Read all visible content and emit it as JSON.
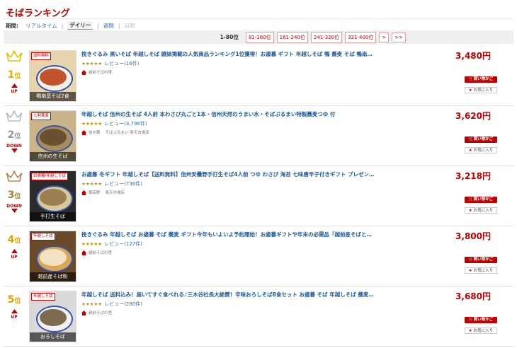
{
  "page": {
    "title": "そばランキング"
  },
  "period": {
    "label": "期間:",
    "options": [
      "リアルタイム",
      "デイリー",
      "週間",
      "月間"
    ]
  },
  "pager": {
    "current": "1-80位",
    "pages": [
      "81-160位",
      "161-240位",
      "241-320位",
      "321-400位",
      ">",
      ">>"
    ]
  },
  "colors": {
    "accent": "#bf0000",
    "link": "#1d5b9b",
    "gold": "#e6c000",
    "silver": "#b0bec5",
    "bronze": "#b08a55"
  },
  "labels": {
    "cart": "買い物かご",
    "fav": "お気に入り",
    "rank_suffix": "位"
  },
  "items": [
    {
      "rank": "1",
      "change": "UP",
      "title": "挽きぐるみ 黒いそば 年越しそば 雑誌掲載の人気商品ランキング1位獲得！お歳暮 ギフト 年越しそば 鴨 蕎麦 そば 鴨南…",
      "stars": "★★★★★",
      "reviews": "レビュー(16件)",
      "shop": "越前そばの里",
      "shop_extra": "",
      "price": "3,480円",
      "img_caption": "鴨南蛮そば2食",
      "img_tag": "送料無料"
    },
    {
      "rank": "2",
      "change": "DOWN",
      "title": "年越しそば 信州の生そば 4人前 本わさび丸ごと1本・信州天然のうまい水・そばぷるまい特製蕎麦つゆ 付",
      "stars": "★★★★★",
      "reviews": "レビュー(3,796件)",
      "shop": "信州蕎",
      "shop_extra": "そばぷるまい 楽天市場店",
      "price": "3,620円",
      "img_caption": "信州の生そば",
      "img_tag": "七割蕎麦"
    },
    {
      "rank": "3",
      "change": "DOWN",
      "title": "お歳暮 冬ギフト 年越しそば【送料無料】信州安曇野手打生そば4人前 つゆ わさび 海苔 七味唐辛子付きギフト プレゼン…",
      "stars": "★★★★★",
      "reviews": "レビュー(736件)",
      "shop": "穂高野",
      "shop_extra": "楽天市場店",
      "price": "3,218円",
      "img_caption": "手打生そば",
      "img_tag": "お歳暮/年越しそば"
    },
    {
      "rank": "4",
      "change": "UP",
      "title": "挽きぐるみ 年越しそば お歳暮 そば 蕎麦 ギフト今年もいよいよ予約開始！お歳暮ギフトや年末の必需品「越前産そばと…",
      "stars": "★★★★★",
      "reviews": "レビュー(127件)",
      "shop": "越前そばの里",
      "shop_extra": "",
      "price": "3,800円",
      "img_caption": "越前産そば粉",
      "img_tag": "年越しそば"
    },
    {
      "rank": "5",
      "change": "UP",
      "title": "年越しそば 送料込み！届いてすぐ食べれる♪三木谷社長大絶賛！辛味おろしそば8食セット お歳暮 そば 年越しそば 蕎麦…",
      "stars": "★★★★★",
      "reviews": "レビュー(280件)",
      "shop": "越前そばの里",
      "shop_extra": "",
      "price": "3,680円",
      "img_caption": "おろしそば",
      "img_tag": "年越しそば"
    }
  ]
}
